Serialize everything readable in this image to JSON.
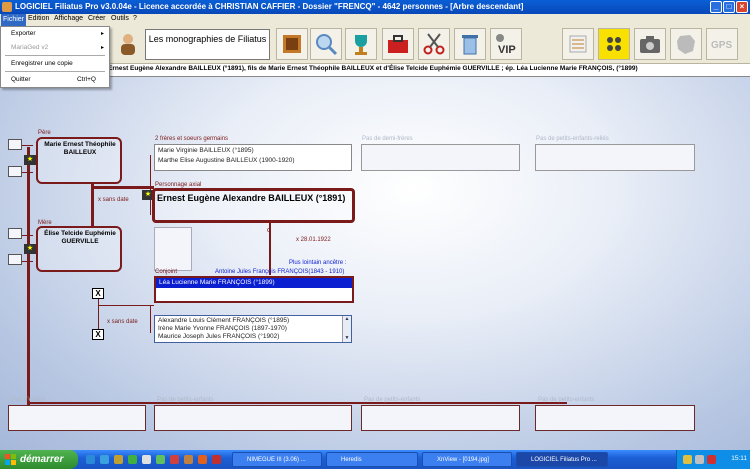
{
  "window": {
    "title": "LOGICIEL Filiatus Pro v3.0.04e - Licence accordée à CHRISTIAN CAFFIER - Dossier \"FRENCQ\" - 4642 personnes - [Arbre descendant]",
    "minimize": "_",
    "maximize": "□",
    "close": "×"
  },
  "menubar": {
    "items": [
      "Fichier",
      "Edition",
      "Affichage",
      "Créer",
      "Outils",
      "?"
    ]
  },
  "file_menu": {
    "export": "Exporter",
    "mariaged": "MariaGed v2",
    "save_copy": "Enregistrer une copie",
    "quit": "Quitter",
    "quit_shortcut": "Ctrl+Q",
    "submenu_arrow": "▸"
  },
  "toolbar": {
    "monographies_label": "Les monographies de Filiatus",
    "icons": [
      "person-icon",
      "book-icon",
      "magnifier-icon",
      "trophy-icon",
      "toolbox-icon",
      "scissors-icon",
      "trash-icon",
      "vip-icon",
      "list-icon",
      "coins-icon",
      "camera-icon",
      "france-map-icon",
      "gps-icon"
    ]
  },
  "infobar": {
    "text": "Ernest Eugène Alexandre BAILLEUX (°1891), fils de Marie Ernest Théophile BAILLEUX et d'Élise Telcide Euphémie GUERVILLE ; ép. Léa Lucienne Marie FRANÇOIS, (°1899)"
  },
  "tree": {
    "father_label": "Père",
    "father_name": "Marie Ernest Théophile BAILLEUX",
    "mother_label": "Mère",
    "mother_name": "Élise Telcide Euphémie GUERVILLE",
    "parents_marriage": "x sans date",
    "siblings_label": "2 frères et soeurs germains",
    "siblings": [
      "Marie Virginie BAILLEUX (°1895)",
      "Marthe Elise Augustine BAILLEUX (1900-1920)"
    ],
    "half_siblings_label": "Pas de demi-frères",
    "step_siblings_label": "Pas de petits-enfants-reliés",
    "axial_label": "Personnage axial",
    "axial_name": "Ernest Eugène Alexandre BAILLEUX (°1891)",
    "marriage_date": "x 28.01.1922",
    "ancestor_label": "Plus lointain ancêtre :",
    "ancestor_name": "Antoine Jules François FRANÇOIS(1843 - 1910)",
    "spouse_label": "Conjoint",
    "spouse_name": "Léa Lucienne Marie FRANÇOIS (°1899)",
    "spouse_parents_marriage": "x sans date",
    "spouse_siblings": [
      "Alexandre Louis Clément FRANÇOIS (°1895)",
      "Irène Marie Yvonne FRANÇOIS (1897-1970)",
      "Maurice Joseph Jules FRANÇOIS (°1902)"
    ],
    "x_mark": "X",
    "star": "★",
    "bottom_labels": [
      "Pas d'enfant",
      "Pas de petits-enfants",
      "Pas de petits-enfants",
      "Pas de petits-enfants"
    ]
  },
  "taskbar": {
    "start": "démarrer",
    "tasks": [
      "NIMEGUE III (3.06) ...",
      "Heredis",
      "XnView - [0194.jpg]",
      "LOGICIEL Filiatus Pro ..."
    ],
    "clock": "15:11"
  },
  "colors": {
    "accent": "#7a1a1a",
    "selection": "#0a1fd0",
    "titlebar": "#0a5fd6"
  }
}
